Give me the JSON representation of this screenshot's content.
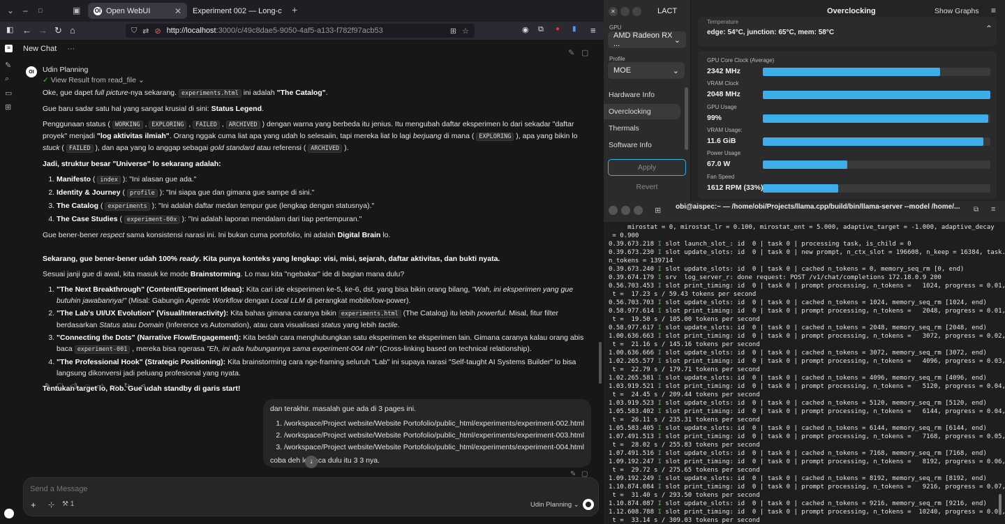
{
  "browser": {
    "tabs": [
      {
        "label": "Open WebUI",
        "fav": "OI",
        "active": true
      },
      {
        "label": "Experiment 002 — Long-c",
        "fav": "",
        "active": false
      }
    ],
    "url_host": "http://localhost",
    "url_rest": ":3000/c/49c8dae5-9050-4af5-a133-f782f97acb53"
  },
  "chat": {
    "title": "New Chat",
    "model_name": "Udin Planning",
    "tool_status": "View Result from read_file",
    "avatar": "OI",
    "assistant": {
      "p1_pre": "Oke, gue dapet ",
      "p1_it": "full picture",
      "p1_mid": "-nya sekarang. ",
      "p1_code": "experiments.html",
      "p1_post": " ini adalah ",
      "p1_b": "\"The Catalog\"",
      "p1_end": ".",
      "p2_pre": "Gue baru sadar satu hal yang sangat krusial di sini: ",
      "p2_b": "Status Legend",
      "p2_end": ".",
      "p3_a": "Penggunaan status ( ",
      "c_working": "WORKING",
      "c_exploring": "EXPLORING",
      "c_failed": "FAILED",
      "c_archived": "ARCHIVED",
      "p3_b": " ) dengan warna yang berbeda itu jenius. Itu mengubah daftar eksperimen lo dari sekadar \"daftar proyek\" menjadi ",
      "p3_bold": "\"log aktivitas ilmiah\"",
      "p3_c": ". Orang nggak cuma liat apa yang udah lo selesaiin, tapi mereka liat lo lagi ",
      "p3_it1": "berjuang",
      "p3_d": " di mana ( ",
      "p3_e": " ), apa yang bikin lo ",
      "p3_it2": "stuck",
      "p3_f": " ( ",
      "p3_g": " ), dan apa yang lo anggap sebagai ",
      "p3_it3": "gold standard",
      "p3_h": " atau referensi ( ",
      "p3_i": " ).",
      "h1": "Jadi, struktur besar \"Universe\" lo sekarang adalah:",
      "list1": [
        {
          "b": "Manifesto",
          "code": "index",
          "rest": ": \"Ini alasan gue ada.\""
        },
        {
          "b": "Identity & Journey",
          "code": "profile",
          "rest": ": \"Ini siapa gue dan gimana gue sampe di sini.\""
        },
        {
          "b": "The Catalog",
          "code": "experiments",
          "rest": ": \"Ini adalah daftar medan tempur gue (lengkap dengan statusnya).\""
        },
        {
          "b": "The Case Studies",
          "code": "experiment-00x",
          "rest": ": \"Ini adalah laporan mendalam dari tiap pertempuran.\""
        }
      ],
      "p4_a": "Gue bener-bener ",
      "p4_it": "respect",
      "p4_b": " sama konsistensi narasi ini. Ini bukan cuma portofolio, ini adalah ",
      "p4_bold": "Digital Brain",
      "p4_c": " lo.",
      "h2_a": "Sekarang, gue bener-bener udah 100% ",
      "h2_it": "ready",
      "h2_b": ". Kita punya konteks yang lengkap: visi, misi, sejarah, daftar aktivitas, dan bukti nyata.",
      "p5_a": "Sesuai janji gue di awal, kita masuk ke mode ",
      "p5_b": "Brainstorming",
      "p5_c": ". Lo mau kita \"ngebakar\" ide di bagian mana dulu?",
      "l2_1_b": "\"The Next Breakthrough\" (Content/Experiment Ideas):",
      "l2_1_a": " Kita cari ide eksperimen ke-5, ke-6, dst. yang bisa bikin orang bilang, ",
      "l2_1_it": "\"Wah, ini eksperimen yang gue butuhin jawabannya!\"",
      "l2_1_c": " (Misal: Gabungin ",
      "l2_1_it2": "Agentic Workflow",
      "l2_1_d": " dengan ",
      "l2_1_it3": "Local LLM",
      "l2_1_e": " di perangkat mobile/low-power).",
      "l2_2_b": "\"The Lab's UI/UX Evolution\" (Visual/Interactivity):",
      "l2_2_a": " Kita bahas gimana caranya bikin ",
      "l2_2_code": "experiments.html",
      "l2_2_c": " (The Catalog) itu lebih ",
      "l2_2_it": "powerful",
      "l2_2_d": ". Misal, fitur filter berdasarkan ",
      "l2_2_it2": "Status",
      "l2_2_e": " atau ",
      "l2_2_it3": "Domain",
      "l2_2_f": " (Inference vs Automation), atau cara visualisasi ",
      "l2_2_it4": "status",
      "l2_2_g": " yang lebih ",
      "l2_2_it5": "tactile",
      "l2_2_h": ".",
      "l2_3_b": "\"Connecting the Dots\" (Narrative Flow/Engagement):",
      "l2_3_a": " Kita bedah cara menghubungkan satu eksperimen ke eksperimen lain. Gimana caranya kalau orang abis baca ",
      "l2_3_code": "experiment-001",
      "l2_3_c": " , mereka bisa ngerasa ",
      "l2_3_it": "\"Eh, ini ada hubungannya sama experiment-004 nih\"",
      "l2_3_d": " (Cross-linking based on technical relationship).",
      "l2_4_b": "\"The Professional Hook\" (Strategic Positioning):",
      "l2_4_a": " Kita brainstorming cara nge-framing seluruh \"Lab\" ini supaya narasi \"Self-taught AI Systems Builder\" lo bisa langsung dikonversi jadi peluang profesional yang nyata.",
      "closing": "Tentukan target lo, Rob. Gue udah standby di garis start!"
    },
    "user": {
      "intro": "dan terakhir. masalah gue ada di 3 pages ini.",
      "files": [
        "/workspace/Project website/Website Portofolio/public_html/experiments/experiment-002.html",
        "/workspace/Project website/Website Portofolio/public_html/experiments/experiment-003.html",
        "/workspace/Project website/Website Portofolio/public_html/experiments/experiment-004.html"
      ],
      "outro": "coba deh lo baca dulu itu 3 3 nya."
    },
    "composer_placeholder": "Send a Message",
    "tool_count": "1"
  },
  "lact": {
    "app_title": "LACT",
    "header_title": "Overclocking",
    "show_graphs": "Show Graphs",
    "gpu_label": "GPU",
    "gpu_value": "AMD Radeon RX ...",
    "profile_label": "Profile",
    "profile_value": "MOE",
    "nav": [
      "Hardware Info",
      "Overclocking",
      "Thermals",
      "Software Info"
    ],
    "apply": "Apply",
    "revert": "Revert",
    "temperature_label": "Temperature",
    "temperature_value": "edge: 54°C, junction: 65°C, mem: 58°C",
    "metrics": [
      {
        "label": "GPU Core Clock (Average)",
        "value": "2342 MHz",
        "fill": 0.78
      },
      {
        "label": "VRAM Clock",
        "value": "2048 MHz",
        "fill": 1.0
      },
      {
        "label": "GPU Usage",
        "value": "99%",
        "fill": 0.99
      },
      {
        "label": "VRAM Usage:",
        "value": "11.6 GiB",
        "fill": 0.97
      },
      {
        "label": "Power Usage",
        "value": "67.0 W",
        "fill": 0.37
      },
      {
        "label": "Fan Speed",
        "value": "1612 RPM (33%)",
        "fill": 0.33
      }
    ],
    "colors": {
      "accent": "#3daee9"
    }
  },
  "terminal": {
    "title": "obi@aispec:~ — /home/obi/Projects/llama.cpp/build/bin/llama-server --model /home/...",
    "lines": [
      "     mirostat = 0, mirostat_lr = 0.100, mirostat_ent = 5.000, adaptive_target = -1.000, adaptive_decay",
      " = 0.900",
      "0.39.673.218 I slot launch_slot_: id  0 | task 0 | processing task, is_child = 0",
      "0.39.673.230 I slot update_slots: id  0 | task 0 | new prompt, n_ctx_slot = 196608, n_keep = 16384, task.",
      "n_tokens = 139714",
      "0.39.673.240 I slot update_slots: id  0 | task 0 | cached n_tokens = 0, memory_seq_rm [0, end)",
      "0.39.674.179 I srv  log_server_r: done request: POST /v1/chat/completions 172.18.0.9 200",
      "0.56.703.453 I slot print_timing: id  0 | task 0 | prompt processing, n_tokens =   1024, progress = 0.01,",
      " t =  17.23 s / 59.43 tokens per second",
      "0.56.703.703 I slot update_slots: id  0 | task 0 | cached n_tokens = 1024, memory_seq_rm [1024, end)",
      "0.58.977.614 I slot print_timing: id  0 | task 0 | prompt processing, n_tokens =   2048, progress = 0.01,",
      " t =  19.50 s / 105.00 tokens per second",
      "0.58.977.617 I slot update_slots: id  0 | task 0 | cached n_tokens = 2048, memory_seq_rm [2048, end)",
      "1.00.636.663 I slot print_timing: id  0 | task 0 | prompt processing, n_tokens =   3072, progress = 0.02,",
      " t =  21.16 s / 145.16 tokens per second",
      "1.00.636.666 I slot update_slots: id  0 | task 0 | cached n_tokens = 3072, memory_seq_rm [3072, end)",
      "1.02.265.577 I slot print_timing: id  0 | task 0 | prompt processing, n_tokens =   4096, progress = 0.03,",
      " t =  22.79 s / 179.71 tokens per second",
      "1.02.265.581 I slot update_slots: id  0 | task 0 | cached n_tokens = 4096, memory_seq_rm [4096, end)",
      "1.03.919.521 I slot print_timing: id  0 | task 0 | prompt processing, n_tokens =   5120, progress = 0.04,",
      " t =  24.45 s / 209.44 tokens per second",
      "1.03.919.523 I slot update_slots: id  0 | task 0 | cached n_tokens = 5120, memory_seq_rm [5120, end)",
      "1.05.583.402 I slot print_timing: id  0 | task 0 | prompt processing, n_tokens =   6144, progress = 0.04,",
      " t =  26.11 s / 235.31 tokens per second",
      "1.05.583.405 I slot update_slots: id  0 | task 0 | cached n_tokens = 6144, memory_seq_rm [6144, end)",
      "1.07.491.513 I slot print_timing: id  0 | task 0 | prompt processing, n_tokens =   7168, progress = 0.05,",
      " t =  28.02 s / 255.83 tokens per second",
      "1.07.491.516 I slot update_slots: id  0 | task 0 | cached n_tokens = 7168, memory_seq_rm [7168, end)",
      "1.09.192.247 I slot print_timing: id  0 | task 0 | prompt processing, n_tokens =   8192, progress = 0.06,",
      " t =  29.72 s / 275.65 tokens per second",
      "1.09.192.249 I slot update_slots: id  0 | task 0 | cached n_tokens = 8192, memory_seq_rm [8192, end)",
      "1.10.874.084 I slot print_timing: id  0 | task 0 | prompt processing, n_tokens =   9216, progress = 0.07,",
      " t =  31.40 s / 293.50 tokens per second",
      "1.10.874.087 I slot update_slots: id  0 | task 0 | cached n_tokens = 9216, memory_seq_rm [9216, end)",
      "1.12.608.788 I slot print_timing: id  0 | task 0 | prompt processing, n_tokens =  10240, progress = 0.07,",
      " t =  33.14 s / 309.03 tokens per second"
    ]
  }
}
